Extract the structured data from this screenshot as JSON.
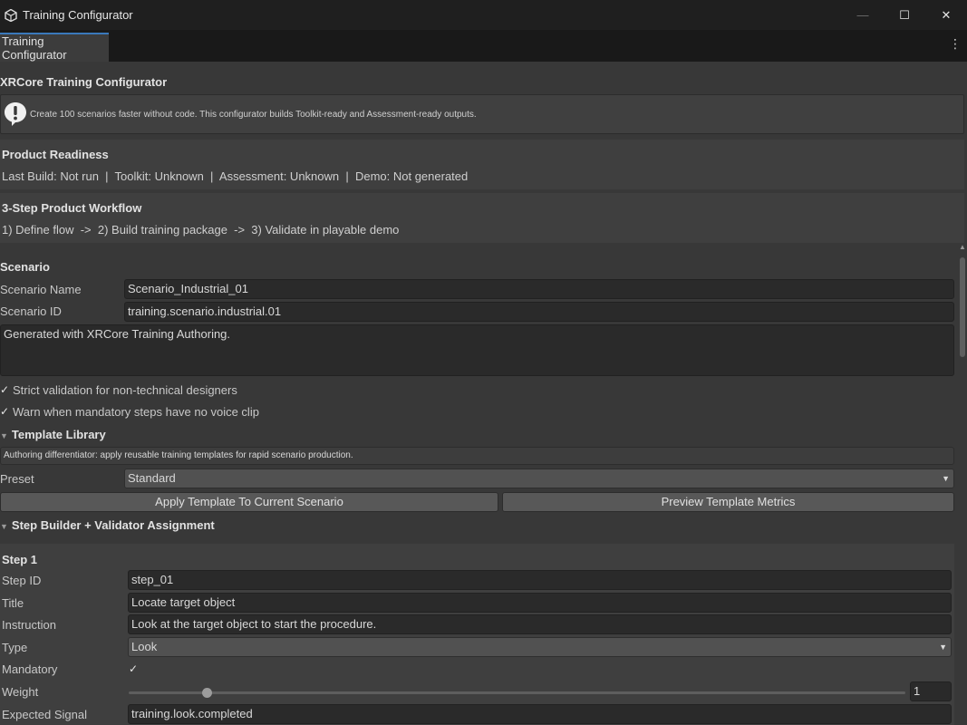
{
  "window": {
    "title": "Training Configurator",
    "controls": {
      "minimize": "—",
      "maximize": "☐",
      "close": "✕"
    }
  },
  "tab": {
    "label": "Training Configurator",
    "menu_glyph": "⋮"
  },
  "header": {
    "title": "XRCore Training Configurator"
  },
  "help": {
    "icon": "exclamation-icon",
    "text": "Create 100 scenarios faster without code. This configurator builds Toolkit-ready and Assessment-ready outputs."
  },
  "readiness": {
    "title": "Product Readiness",
    "status": "Last Build: Not run  |  Toolkit: Unknown  |  Assessment: Unknown  |  Demo: Not generated"
  },
  "workflow": {
    "title": "3-Step Product Workflow",
    "steps": "1) Define flow  ->  2) Build training package  ->  3) Validate in playable demo"
  },
  "scenario": {
    "section": "Scenario",
    "name_label": "Scenario Name",
    "name_value": "Scenario_Industrial_01",
    "id_label": "Scenario ID",
    "id_value": "training.scenario.industrial.01",
    "description": "Generated with XRCore Training Authoring.",
    "strict_validation": {
      "label": "Strict validation for non-technical designers",
      "checked": true
    },
    "warn_voice": {
      "label": "Warn when mandatory steps have no voice clip",
      "checked": true
    }
  },
  "template_library": {
    "title": "Template Library",
    "note": "Authoring differentiator: apply reusable training templates for rapid scenario production.",
    "preset_label": "Preset",
    "preset_value": "Standard",
    "apply_button": "Apply Template To Current Scenario",
    "preview_button": "Preview Template Metrics"
  },
  "step_builder": {
    "title": "Step Builder + Validator Assignment",
    "step": {
      "heading": "Step 1",
      "id_label": "Step ID",
      "id_value": "step_01",
      "title_label": "Title",
      "title_value": "Locate target object",
      "instruction_label": "Instruction",
      "instruction_value": "Look at the target object to start the procedure.",
      "type_label": "Type",
      "type_value": "Look",
      "mandatory_label": "Mandatory",
      "mandatory_checked": true,
      "weight_label": "Weight",
      "weight_value": "1",
      "weight_fraction": 0.1,
      "signal_label": "Expected Signal",
      "signal_value": "training.look.completed"
    }
  },
  "glyphs": {
    "check": "✓",
    "dropdown": "▼",
    "foldout": "▼",
    "scroll_up": "▲"
  }
}
